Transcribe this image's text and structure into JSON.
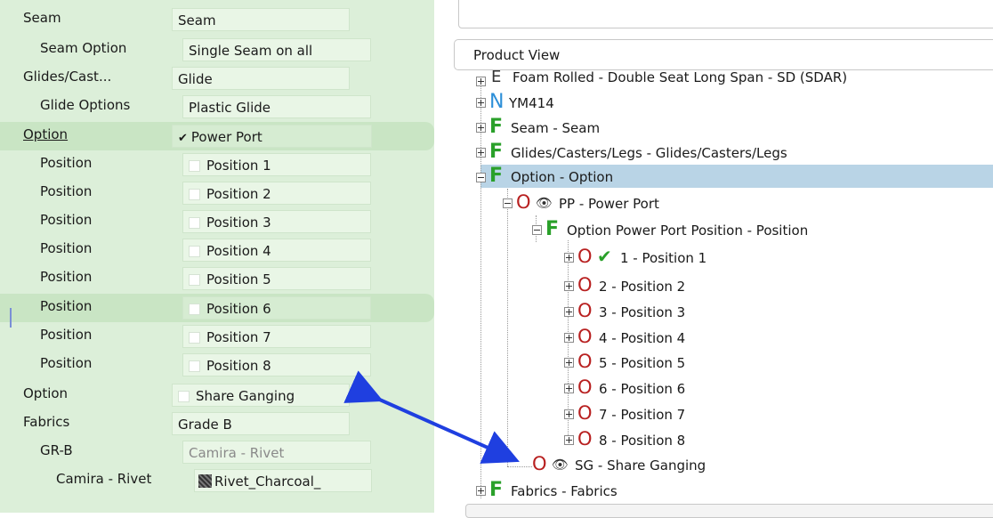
{
  "config": {
    "rows": [
      {
        "label": "Seam",
        "value": "Seam",
        "label_x": 26,
        "val_x": 193,
        "val_w": 200
      },
      {
        "label": "Seam Option",
        "value": "Single Seam on all",
        "label_x": 45,
        "val_x": 205,
        "val_w": 212
      },
      {
        "label": "Glides/Cast...",
        "value": "Glide",
        "label_x": 26,
        "val_x": 193,
        "val_w": 200
      },
      {
        "label": "Glide Options",
        "value": "Plastic Glide",
        "label_x": 45,
        "val_x": 205,
        "val_w": 212
      },
      {
        "label": "Option",
        "value": "Power Port",
        "label_x": 26,
        "val_x": 193,
        "val_w": 225
      },
      {
        "label": "Position",
        "value": "Position 1",
        "label_x": 45,
        "val_x": 205,
        "val_w": 212
      },
      {
        "label": "Position",
        "value": "Position 2",
        "label_x": 45,
        "val_x": 205,
        "val_w": 212
      },
      {
        "label": "Position",
        "value": "Position 3",
        "label_x": 45,
        "val_x": 205,
        "val_w": 212
      },
      {
        "label": "Position",
        "value": "Position 4",
        "label_x": 45,
        "val_x": 205,
        "val_w": 212
      },
      {
        "label": "Position",
        "value": "Position 5",
        "label_x": 45,
        "val_x": 205,
        "val_w": 212
      },
      {
        "label": "Position",
        "value": "Position 6",
        "label_x": 45,
        "val_x": 205,
        "val_w": 212
      },
      {
        "label": "Position",
        "value": "Position 7",
        "label_x": 45,
        "val_x": 205,
        "val_w": 212
      },
      {
        "label": "Position",
        "value": "Position 8",
        "label_x": 45,
        "val_x": 205,
        "val_w": 212
      },
      {
        "label": "Option",
        "value": "Share Ganging",
        "label_x": 26,
        "val_x": 193,
        "val_w": 200
      },
      {
        "label": "Fabrics",
        "value": "Grade B",
        "label_x": 26,
        "val_x": 193,
        "val_w": 200
      },
      {
        "label": "GR-B",
        "value": "Camira - Rivet",
        "label_x": 45,
        "val_x": 205,
        "val_w": 212
      },
      {
        "label": "Camira - Rivet",
        "value": "Rivet_Charcoal_",
        "label_x": 63,
        "val_x": 218,
        "val_w": 200
      }
    ],
    "power_port_checked": "✔"
  },
  "product_view": {
    "title": "Product View",
    "tree": [
      {
        "text": "Foam Rolled - Double Seat Long Span - SD (SDAR)",
        "letter": "E"
      },
      {
        "text": "YM414",
        "letter": "N"
      },
      {
        "text": "Seam - Seam",
        "letter": "F"
      },
      {
        "text": "Glides/Casters/Legs - Glides/Casters/Legs",
        "letter": "F"
      },
      {
        "text": "Option - Option",
        "letter": "F"
      },
      {
        "text": "PP - Power Port",
        "letter": "O"
      },
      {
        "text": "Option Power Port Position - Position",
        "letter": "F"
      },
      {
        "text": "1 - Position 1",
        "letter": "O"
      },
      {
        "text": "2 - Position 2",
        "letter": "O"
      },
      {
        "text": "3 - Position 3",
        "letter": "O"
      },
      {
        "text": "4 - Position 4",
        "letter": "O"
      },
      {
        "text": "5 - Position 5",
        "letter": "O"
      },
      {
        "text": "6 - Position 6",
        "letter": "O"
      },
      {
        "text": "7 - Position 7",
        "letter": "O"
      },
      {
        "text": "8 - Position 8",
        "letter": "O"
      },
      {
        "text": "SG - Share Ganging",
        "letter": "O"
      },
      {
        "text": "Fabrics - Fabrics",
        "letter": "F"
      }
    ]
  },
  "colors": {
    "panel": "#dcefd9",
    "highlight": "#c9e5c4",
    "selection": "#b9d4e6",
    "arrow": "#1f3fe0",
    "feature_green": "#2aa02a",
    "option_red": "#b82020"
  },
  "icons": {
    "eye": "eye-icon",
    "check": "check-icon",
    "expand": "plus-box-icon",
    "collapse": "minus-box-icon"
  }
}
